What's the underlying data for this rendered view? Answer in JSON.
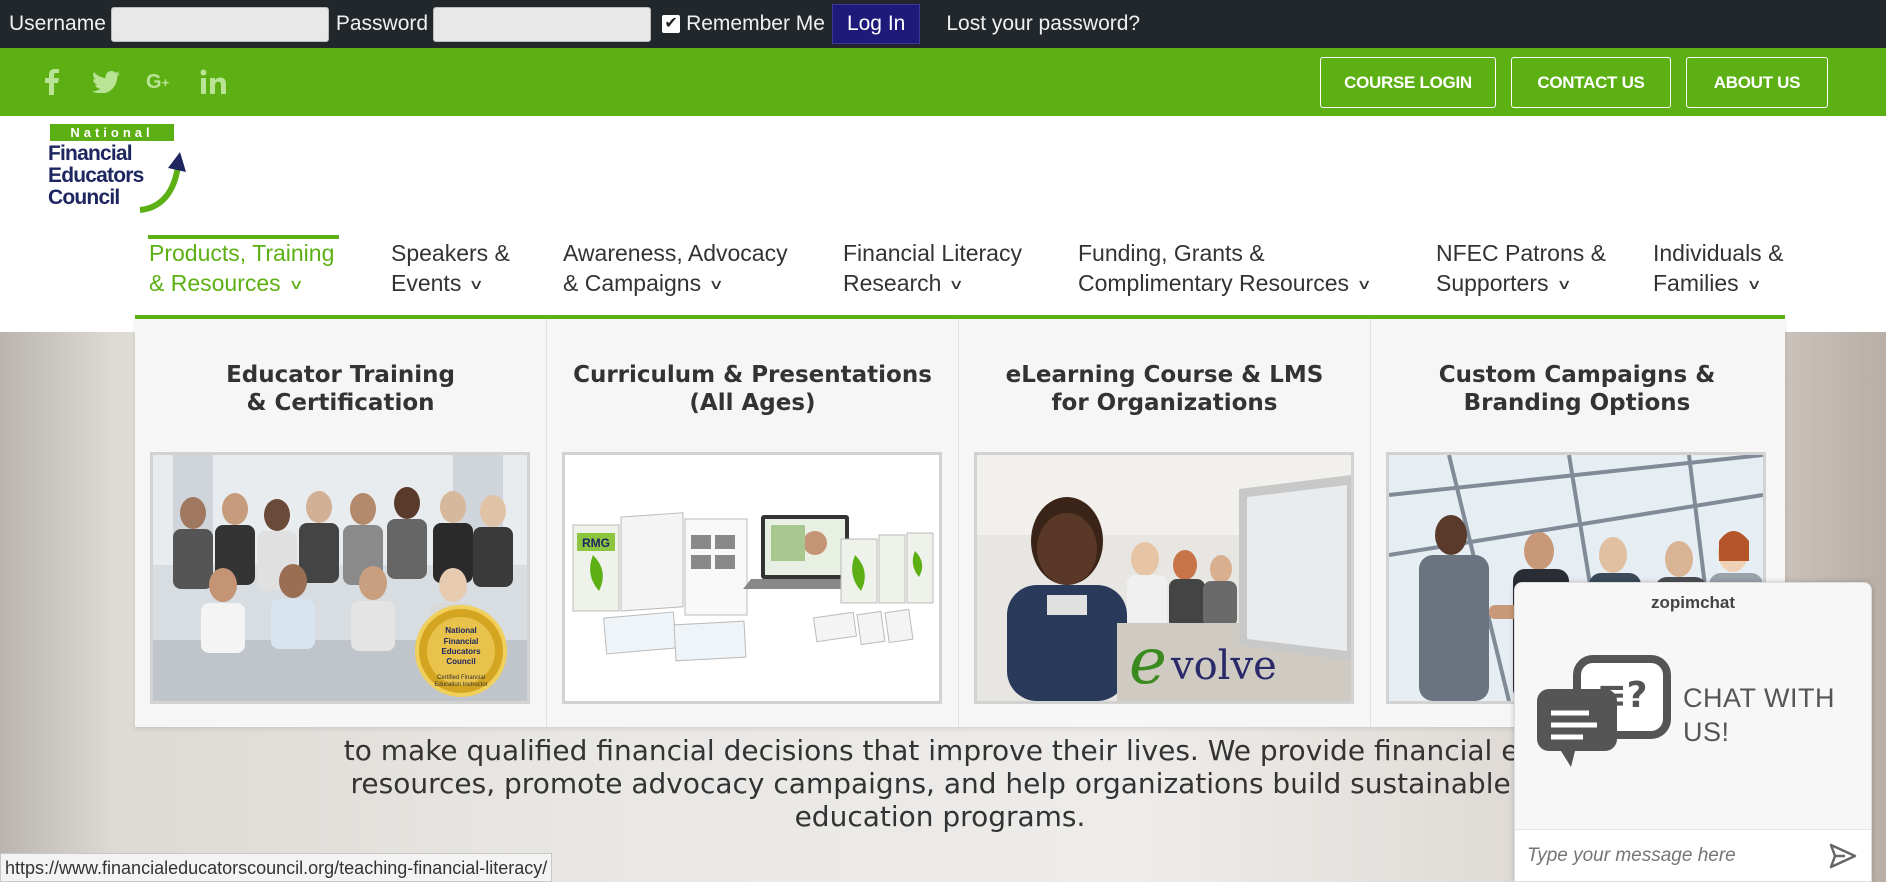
{
  "login_bar": {
    "username_label": "Username",
    "username_value": "",
    "password_label": "Password",
    "password_value": "",
    "remember_label": "Remember Me",
    "remember_checked": true,
    "login_button": "Log In",
    "lost_password": "Lost your password?"
  },
  "header": {
    "social": [
      "facebook-icon",
      "twitter-icon",
      "google-plus-icon",
      "linkedin-icon"
    ],
    "buttons": [
      "COURSE LOGIN",
      "CONTACT US",
      "ABOUT US"
    ],
    "logo": {
      "line0": "National",
      "line1": "Financial",
      "line2": "Educators",
      "line3": "Council"
    }
  },
  "nav": [
    {
      "line1": "Products, Training",
      "line2": "& Resources"
    },
    {
      "line1": "Speakers &",
      "line2": "Events"
    },
    {
      "line1": "Awareness, Advocacy",
      "line2": "& Campaigns"
    },
    {
      "line1": "Financial Literacy",
      "line2": "Research"
    },
    {
      "line1": "Funding, Grants &",
      "line2": "Complimentary Resources"
    },
    {
      "line1": "NFEC Patrons &",
      "line2": "Supporters"
    },
    {
      "line1": "Individuals &",
      "line2": "Families"
    }
  ],
  "mega_menu": {
    "columns": [
      {
        "title": "Educator Training\n& Certification",
        "badge": "National\nFinancial\nEducators\nCouncil\nCertified Financial\nEducation Instructor"
      },
      {
        "title": "Curriculum & Presentations\n(All Ages)",
        "badge": "RMG"
      },
      {
        "title": "eLearning Course & LMS\nfor Organizations",
        "badge": "evolve"
      },
      {
        "title": "Custom Campaigns &\nBranding Options"
      }
    ]
  },
  "hero": {
    "line1": "to make qualified financial decisions that improve their lives. We provide financial ed",
    "line2": "resources, promote advocacy campaigns, and help organizations build sustainable f",
    "line3": "education programs."
  },
  "chat": {
    "brand": "zopimchat",
    "cta_line1": "CHAT WITH",
    "cta_line2": "US!",
    "placeholder": "Type your message here"
  },
  "status_url": "https://www.financialeducatorscouncil.org/teaching-financial-literacy/",
  "colors": {
    "brand_green": "#5cb014",
    "login_bar": "#22272b",
    "login_button": "#1e1a7a",
    "logo_navy": "#1e2660"
  }
}
